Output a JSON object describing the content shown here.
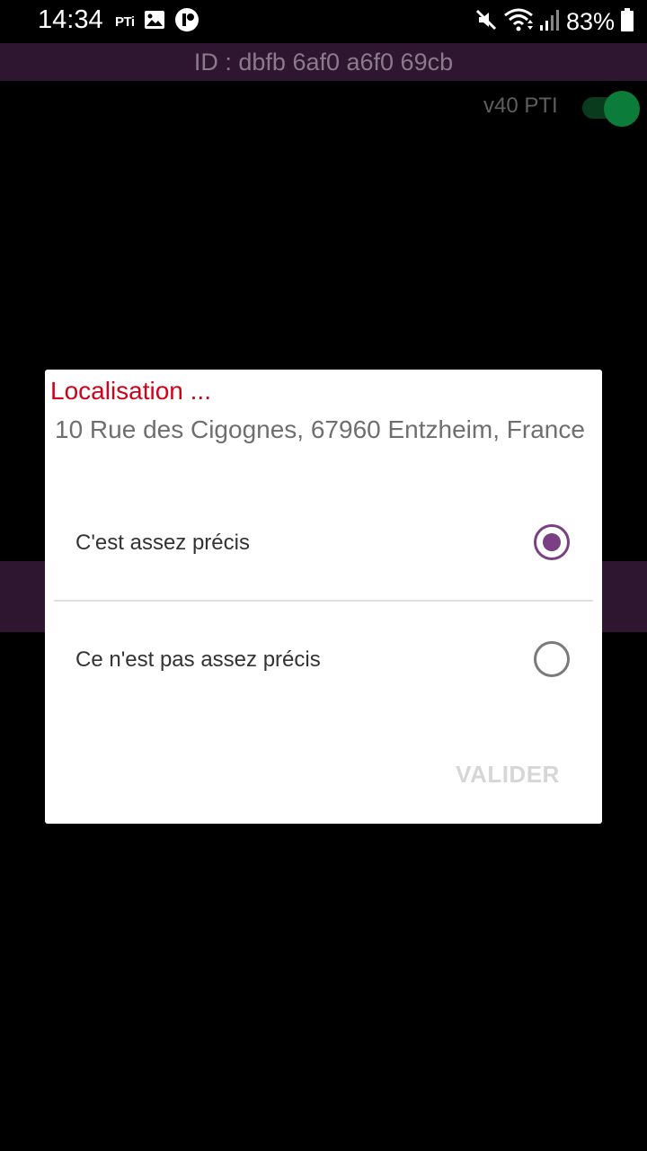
{
  "status_bar": {
    "time": "14:34",
    "left_icons": [
      "pti-app-icon",
      "image-icon",
      "notification-app-icon"
    ],
    "pti_mini_label": "PTi",
    "right_icons": [
      "mute-icon",
      "wifi-icon",
      "signal-icon",
      "battery-icon"
    ],
    "battery_percent": "83%"
  },
  "header": {
    "id_text": "ID : dbfb 6af0 a6f0 69cb",
    "bar_color": "#2e1630"
  },
  "version": {
    "label": "v40 PTI",
    "toggle_on": true,
    "toggle_color": "#0c7c3a"
  },
  "dialog": {
    "title": "Localisation ...",
    "title_color": "#d0021b",
    "address": "10 Rue des Cigognes, 67960 Entzheim, France",
    "options": [
      {
        "label": "C'est assez précis",
        "selected": true
      },
      {
        "label": "Ce n'est pas assez précis",
        "selected": false
      }
    ],
    "accent_color": "#7b3f84",
    "confirm_label": "VALIDER",
    "confirm_enabled": false
  }
}
